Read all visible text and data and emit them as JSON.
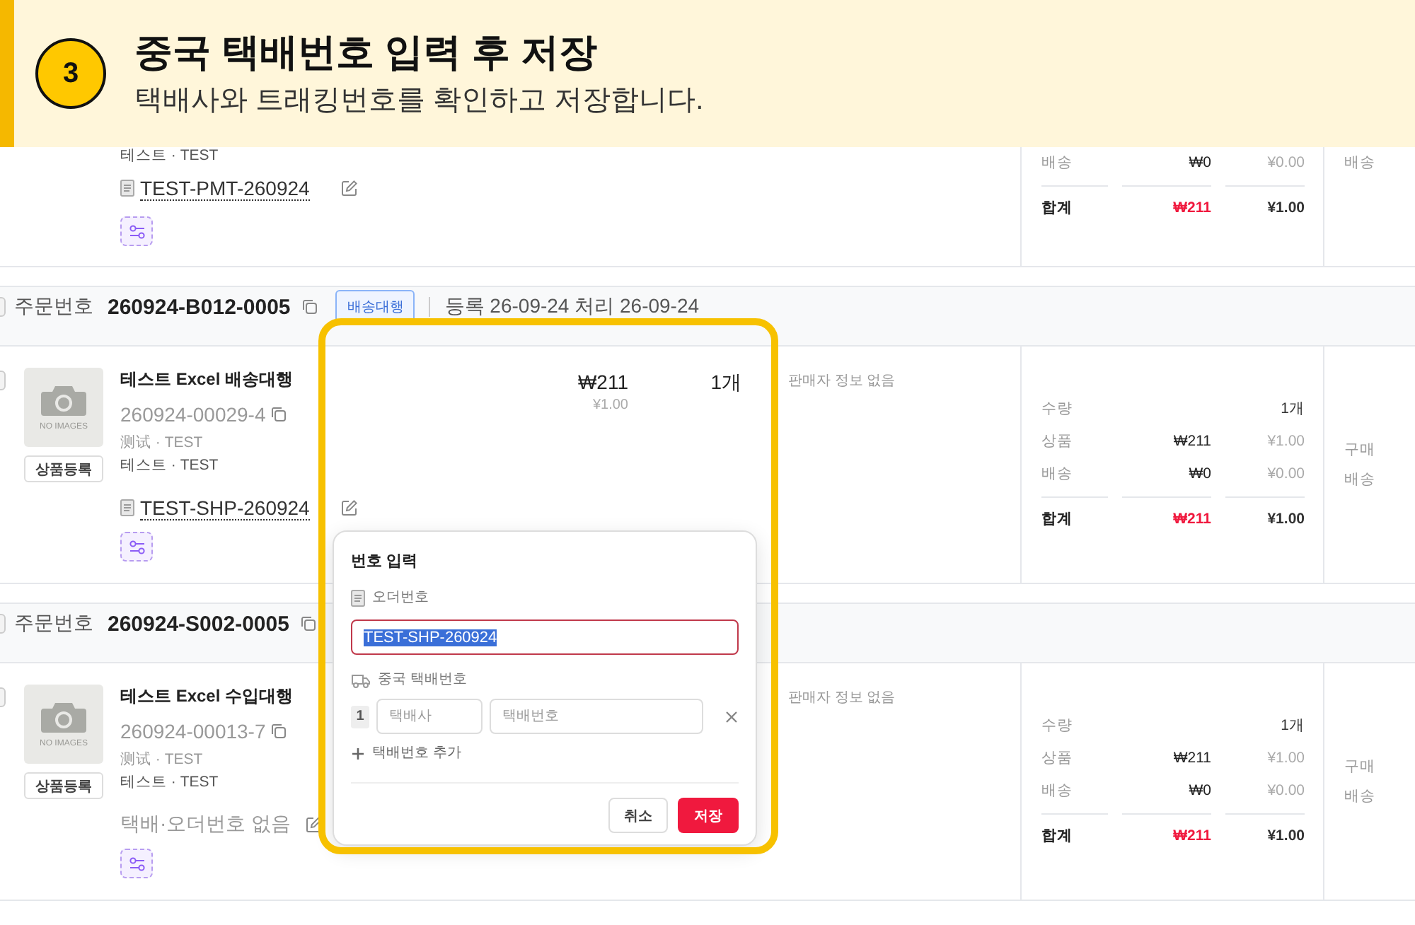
{
  "guide": {
    "step": "3",
    "title": "중국 택배번호 입력 후 저장",
    "subtitle": "택배사와 트래킹번호를 확인하고 저장합니다."
  },
  "orders": [
    {
      "kind": "partial",
      "product": {
        "option": "테스트 · TEST",
        "tracking": "TEST-PMT-260924"
      },
      "summary": [
        {
          "kind": "line",
          "label": "배송",
          "krw": "₩0",
          "cny": "¥0.00"
        },
        {
          "kind": "total",
          "label": "합계",
          "krw": "₩211",
          "cny": "¥1.00"
        }
      ],
      "actions": [
        "배송"
      ]
    },
    {
      "kind": "full",
      "checked": false,
      "header": {
        "label": "주문번호",
        "order_no": "260924-B012-0005",
        "badge": "배송대행",
        "dates": "등록 26-09-24 처리 26-09-24"
      },
      "product": {
        "checked": false,
        "image_text": "NO IMAGES",
        "register": "상품등록",
        "name": "테스트 Excel 배송대행",
        "code": "260924-00029-4",
        "option_cn": "测试 · TEST",
        "option": "테스트 · TEST",
        "tracking": "TEST-SHP-260924"
      },
      "price": {
        "krw": "₩211",
        "cny": "¥1.00"
      },
      "quantity": "1개",
      "seller": "판매자 정보 없음",
      "summary": [
        {
          "kind": "count",
          "label": "수량",
          "value": "1개"
        },
        {
          "kind": "line",
          "label": "상품",
          "krw": "₩211",
          "cny": "¥1.00"
        },
        {
          "kind": "line",
          "label": "배송",
          "krw": "₩0",
          "cny": "¥0.00"
        },
        {
          "kind": "total",
          "label": "합계",
          "krw": "₩211",
          "cny": "¥1.00"
        }
      ],
      "actions": [
        "구매",
        "배송"
      ]
    },
    {
      "kind": "full",
      "checked": false,
      "header": {
        "label": "주문번호",
        "order_no": "260924-S002-0005"
      },
      "product": {
        "checked": false,
        "image_text": "NO IMAGES",
        "register": "상품등록",
        "name": "테스트 Excel 수입대행",
        "code": "260924-00013-7",
        "option_cn": "测试 · TEST",
        "option": "테스트 · TEST",
        "tracking_empty": "택배·오더번호 없음"
      },
      "seller": "판매자 정보 없음",
      "summary": [
        {
          "kind": "count",
          "label": "수량",
          "value": "1개"
        },
        {
          "kind": "line",
          "label": "상품",
          "krw": "₩211",
          "cny": "¥1.00"
        },
        {
          "kind": "line",
          "label": "배송",
          "krw": "₩0",
          "cny": "¥0.00"
        },
        {
          "kind": "total",
          "label": "합계",
          "krw": "₩211",
          "cny": "¥1.00"
        }
      ],
      "actions": [
        "구매",
        "배송"
      ]
    }
  ],
  "popover": {
    "title": "번호 입력",
    "order_label": "오더번호",
    "order_field": {
      "value": "TEST-SHP-260924",
      "highlighted": true,
      "invalid": true
    },
    "tracking_label": "중국 택배번호",
    "tracking_rows": [
      {
        "index": "1",
        "carrier_placeholder": "택배사",
        "number_placeholder": "택배번호"
      }
    ],
    "add_label": "택배번호 추가",
    "cancel": "취소",
    "save": "저장"
  }
}
